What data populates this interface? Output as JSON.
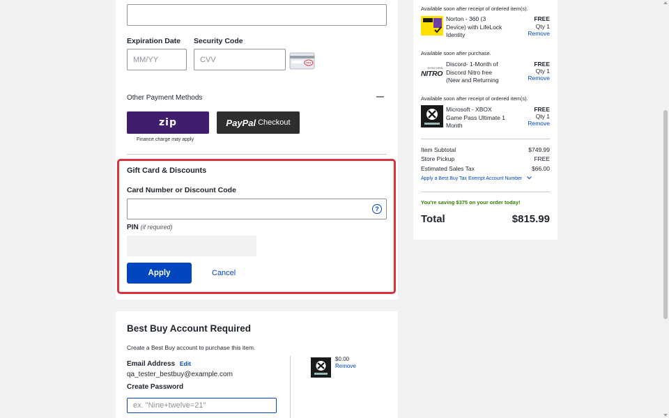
{
  "payment": {
    "expiration_label": "Expiration Date",
    "expiration_placeholder": "MM/YY",
    "security_label": "Security Code",
    "security_placeholder": "CVV",
    "other_methods_label": "Other Payment Methods",
    "collapse_symbol": "—",
    "zip_label": "zip",
    "paypal_brand": "PayPal",
    "paypal_label": "Checkout",
    "finance_note": "Finance charge may apply"
  },
  "gift": {
    "title": "Gift Card & Discounts",
    "card_label": "Card Number or Discount Code",
    "help_symbol": "?",
    "pin_label": "PIN",
    "pin_hint": "(if required)",
    "apply_label": "Apply",
    "cancel_label": "Cancel",
    "accent_color": "#d9313d"
  },
  "account": {
    "title": "Best Buy Account Required",
    "description": "Create a Best Buy account to purchase this item.",
    "email_label": "Email Address",
    "edit_label": "Edit",
    "email_value": "qa_tester_bestbuy@example.com",
    "password_label": "Create Password",
    "password_placeholder": "ex. \"Nine+twelve=21\"",
    "item_price": "$0.00",
    "item_remove": "Remove"
  },
  "summary": {
    "items": [
      {
        "note": "Available soon after receipt of ordered item(s).",
        "name": "Norton - 360 (3 Device) with LifeLock Identity",
        "price": "FREE",
        "qty": "Qty 1",
        "remove": "Remove",
        "icon": "norton-icon"
      },
      {
        "note": "Available soon after purchase.",
        "name": "Discord- 1-Month of Discord Nitro free (New and Returning",
        "price": "FREE",
        "qty": "Qty 1",
        "remove": "Remove",
        "icon": "discord-nitro-icon"
      },
      {
        "note": "Available soon after receipt of ordered item(s).",
        "name": "Microsoft - XBOX Game Pass Ultimate 1 Month",
        "price": "FREE",
        "qty": "Qty 1",
        "remove": "Remove",
        "icon": "xbox-game-pass-icon"
      }
    ],
    "subtotal_label": "Item Subtotal",
    "subtotal_value": "$749.99",
    "pickup_label": "Store Pickup",
    "pickup_value": "FREE",
    "tax_label": "Estimated Sales Tax",
    "tax_value": "$66.00",
    "tax_exempt_link": "Apply a Best Buy Tax Exempt Account Number",
    "savings_text": "You're saving $375 on your order today!",
    "savings_color": "#318000",
    "total_label": "Total",
    "total_value": "$815.99",
    "nitro_logo": "NITRO",
    "discord_small": "DISCORD"
  }
}
